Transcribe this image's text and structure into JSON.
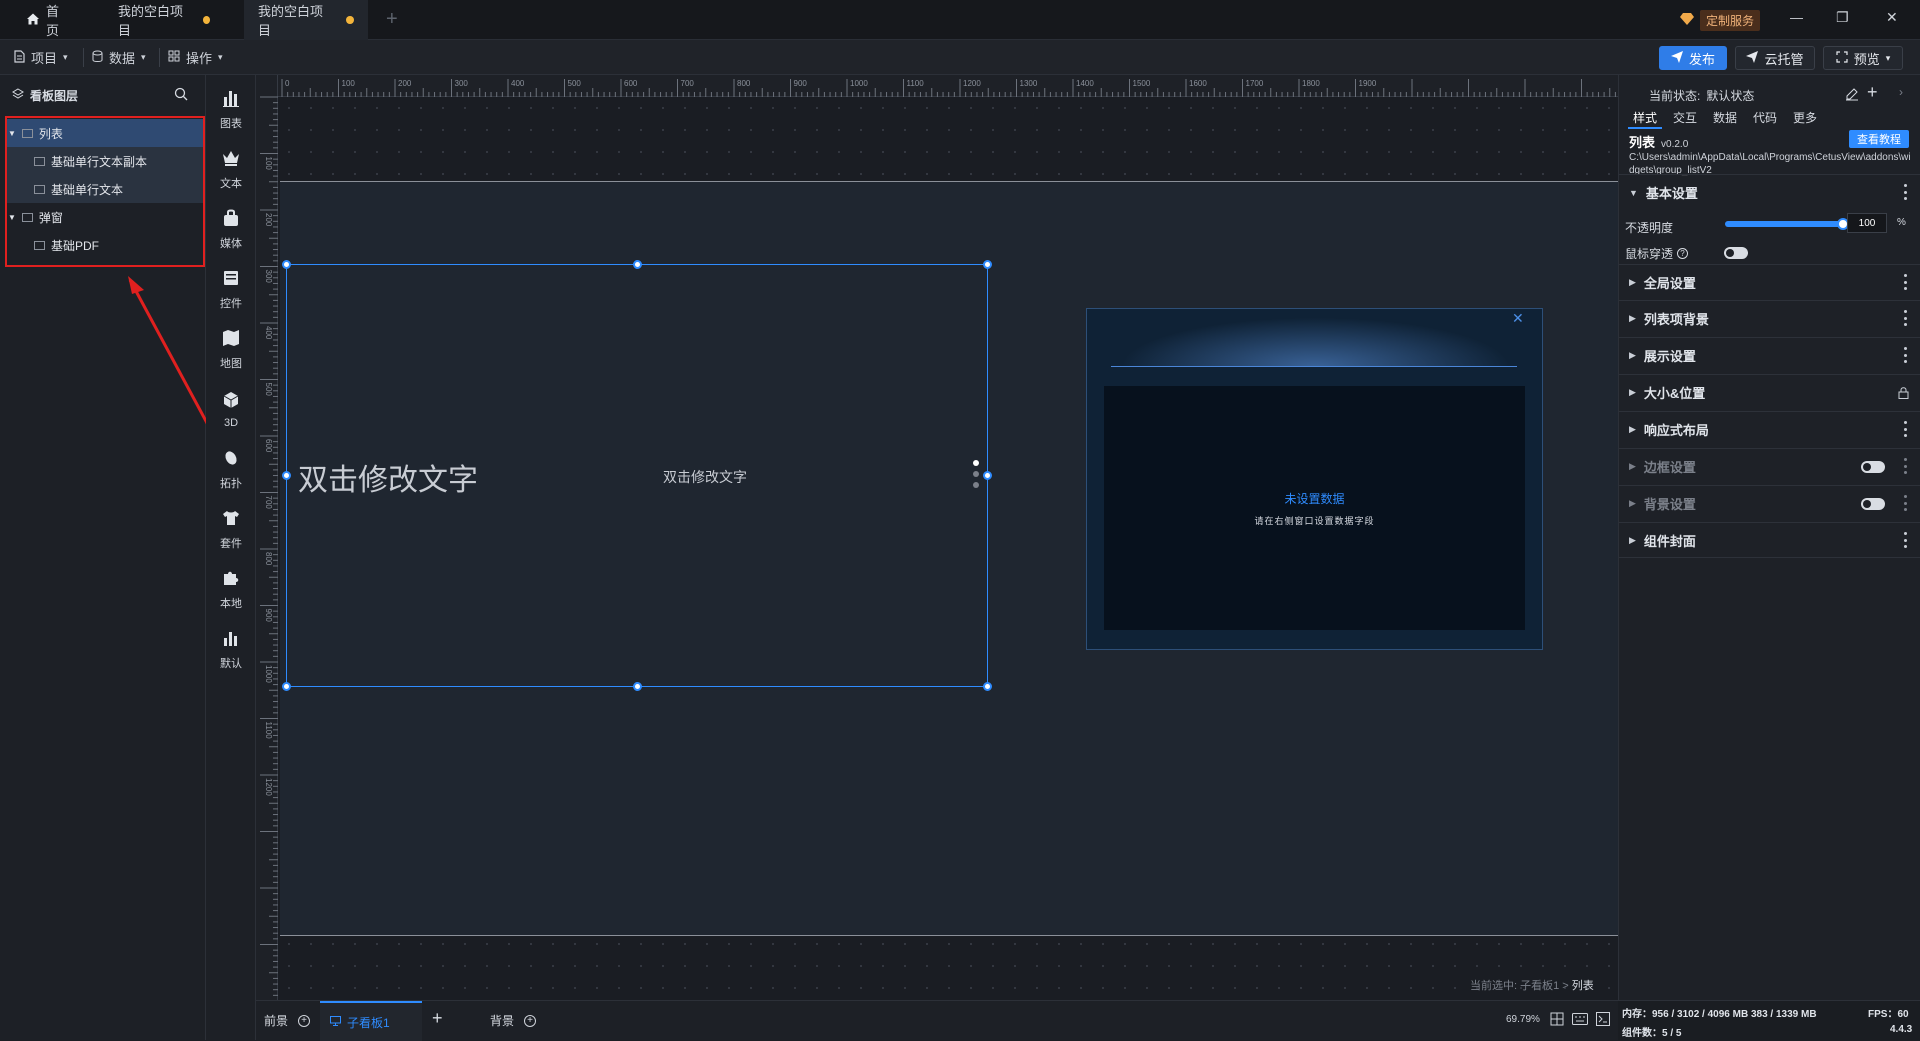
{
  "titlebar": {
    "tabs": [
      {
        "label": "首页",
        "icon": "home-icon"
      },
      {
        "label": "我的空白项目",
        "modified": true
      },
      {
        "label": "我的空白项目",
        "modified": true,
        "active": true
      }
    ],
    "new_tab": "+",
    "custom_service": "定制服务",
    "window": {
      "minimize": "—",
      "restore": "❐",
      "close": "✕"
    }
  },
  "menubar": {
    "items": [
      {
        "label": "项目",
        "icon": "file-icon"
      },
      {
        "label": "数据",
        "icon": "database-icon"
      },
      {
        "label": "操作",
        "icon": "grid-icon"
      }
    ],
    "publish": "发布",
    "cloud_host": "云托管",
    "preview": "预览"
  },
  "layers": {
    "title": "看板图层",
    "items": [
      {
        "label": "列表",
        "level": 0,
        "expanded": true,
        "selected": true
      },
      {
        "label": "基础单行文本副本",
        "level": 1
      },
      {
        "label": "基础单行文本",
        "level": 1
      },
      {
        "label": "弹窗",
        "level": 0,
        "expanded": true
      },
      {
        "label": "基础PDF",
        "level": 1
      }
    ]
  },
  "toolbar": {
    "items": [
      {
        "label": "图表",
        "icon": "chart-icon"
      },
      {
        "label": "文本",
        "icon": "text-crown-icon"
      },
      {
        "label": "媒体",
        "icon": "media-bag-icon"
      },
      {
        "label": "控件",
        "icon": "control-icon"
      },
      {
        "label": "地图",
        "icon": "map-icon"
      },
      {
        "label": "3D",
        "icon": "cube-icon"
      },
      {
        "label": "拓扑",
        "icon": "topology-icon"
      },
      {
        "label": "套件",
        "icon": "shirt-icon"
      },
      {
        "label": "本地",
        "icon": "puzzle-icon"
      },
      {
        "label": "默认",
        "icon": "bar-chart-icon"
      }
    ]
  },
  "rulers": {
    "h_ticks": [
      "0",
      "100",
      "200",
      "300",
      "400",
      "500",
      "600",
      "700",
      "800",
      "900",
      "1000",
      "1100",
      "1200",
      "1300",
      "1400",
      "1500",
      "1600",
      "1700",
      "1800",
      "1900"
    ],
    "v_ticks": [
      "100",
      "200",
      "300",
      "400",
      "500",
      "600",
      "700",
      "800",
      "900",
      "1000",
      "1100",
      "1200"
    ]
  },
  "canvas": {
    "big_text": "双击修改文字",
    "small_text": "双击修改文字",
    "popup_title": "未设置数据",
    "popup_sub": "请在右侧窗口设置数据字段",
    "popup_close": "✕",
    "current_selection_prefix": "当前选中: 子看板1 > ",
    "current_selection_item": "列表"
  },
  "bottom": {
    "tabs": [
      {
        "label": "前景"
      },
      {
        "label": "子看板1",
        "active": true
      },
      {
        "label": "背景"
      }
    ],
    "add": "+",
    "zoom": "69.79%"
  },
  "inspector": {
    "status_label": "当前状态:",
    "status_value": "默认状态",
    "tabs": [
      "样式",
      "交互",
      "数据",
      "代码",
      "更多"
    ],
    "active_tab": "样式",
    "component_name": "列表",
    "component_version": "v0.2.0",
    "tutorial_button": "查看教程",
    "path": "C:\\Users\\admin\\AppData\\Local\\Programs\\CetusView\\addons\\widgets\\group_listV2",
    "sections": [
      {
        "label": "基本设置",
        "expanded": true
      },
      {
        "label": "全局设置"
      },
      {
        "label": "列表项背景"
      },
      {
        "label": "展示设置"
      },
      {
        "label": "大小&位置",
        "locked": true
      },
      {
        "label": "响应式布局"
      },
      {
        "label": "边框设置",
        "dim": true,
        "toggle": true
      },
      {
        "label": "背景设置",
        "dim": true,
        "toggle": true
      },
      {
        "label": "组件封面"
      }
    ],
    "opacity_label": "不透明度",
    "opacity_value": "100",
    "opacity_unit": "%",
    "opacity_level": 1.0,
    "mouse_through_label": "鼠标穿透",
    "mouse_through_on": false
  },
  "statusbar": {
    "memory": "内存：956 / 3102 / 4096 MB  383 / 1339 MB",
    "fps": "FPS：60",
    "components": "组件数：5 / 5",
    "version": "4.4.3"
  },
  "colors": {
    "accent": "#2f8cff",
    "highlight_box": "#e0201f",
    "modified_dot": "#f3b43b"
  }
}
